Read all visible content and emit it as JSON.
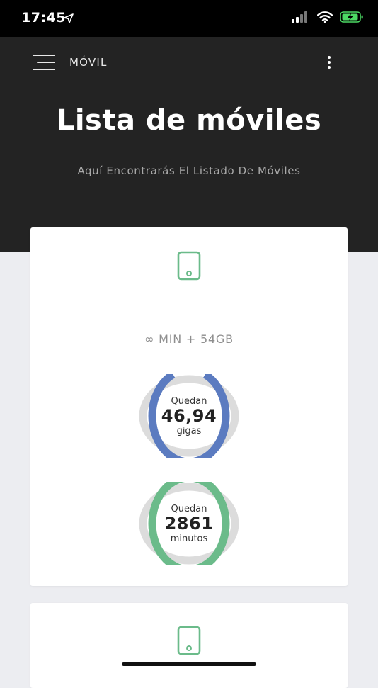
{
  "status_bar": {
    "time": "17:45",
    "icons": [
      "location-arrow-icon",
      "signal-icon",
      "wifi-icon",
      "battery-charging-icon"
    ]
  },
  "header": {
    "menu_label": "MÓVIL",
    "title": "Lista de móviles",
    "subtitle": "Aquí Encontrarás El Listado De Móviles"
  },
  "cards": [
    {
      "icon": "mobile-phone-icon",
      "plan": "∞ MIN + 54GB",
      "data_ring": {
        "top": "Quedan",
        "value": "46,94",
        "unit": "gigas",
        "fraction": 0.87
      },
      "minutes_ring": {
        "top": "Quedan",
        "value": "2861",
        "unit": "minutos",
        "fraction": 0.98
      }
    },
    {
      "icon": "mobile-phone-icon"
    }
  ],
  "colors": {
    "header_bg": "#232323",
    "page_bg": "#ecedf1",
    "data_ring": "#5b7bc0",
    "minutes_ring": "#6bbb8a",
    "ring_track": "#dcdcdc",
    "icon_green": "#6bbb8a"
  }
}
